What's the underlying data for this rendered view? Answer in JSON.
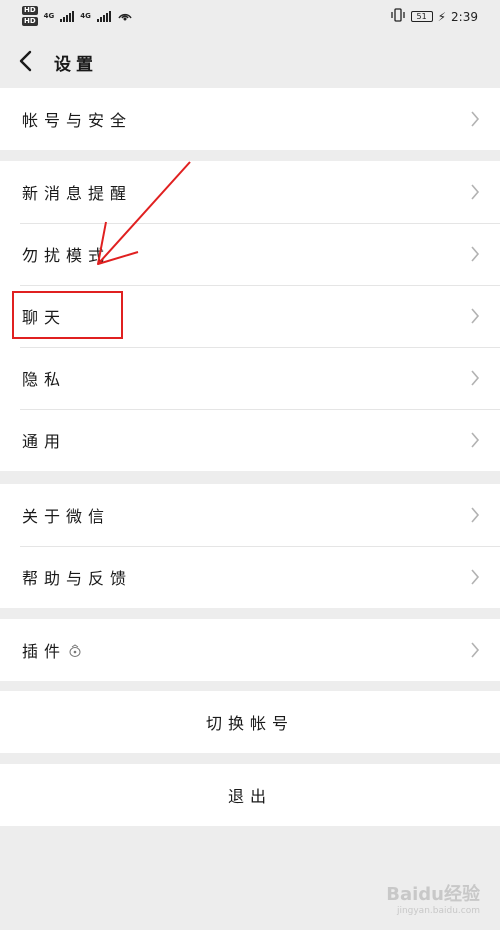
{
  "status_bar": {
    "hd1": "HD",
    "hd2": "HD",
    "net1": "4G",
    "net2": "4G",
    "battery": "51",
    "time": "2:39"
  },
  "nav": {
    "back_icon": "chevron-left-icon",
    "title": "设置"
  },
  "groups": [
    {
      "items": [
        {
          "label": "帐号与安全"
        }
      ]
    },
    {
      "items": [
        {
          "label": "新消息提醒"
        },
        {
          "label": "勿扰模式"
        },
        {
          "label": "聊天"
        },
        {
          "label": "隐私"
        },
        {
          "label": "通用"
        }
      ]
    },
    {
      "items": [
        {
          "label": "关于微信"
        },
        {
          "label": "帮助与反馈"
        }
      ]
    },
    {
      "items": [
        {
          "label": "插件",
          "icon": "plugin-icon"
        }
      ]
    }
  ],
  "actions": {
    "switch_account": "切换帐号",
    "logout": "退出"
  },
  "annotation": {
    "color": "#e02020",
    "highlighted_item": "聊天"
  },
  "watermark": {
    "brand": "Baidu经验",
    "url": "jingyan.baidu.com"
  },
  "colors": {
    "background": "#ededed",
    "row": "#ffffff",
    "divider": "#e5e5e5",
    "chevron": "#b2b2b2"
  }
}
